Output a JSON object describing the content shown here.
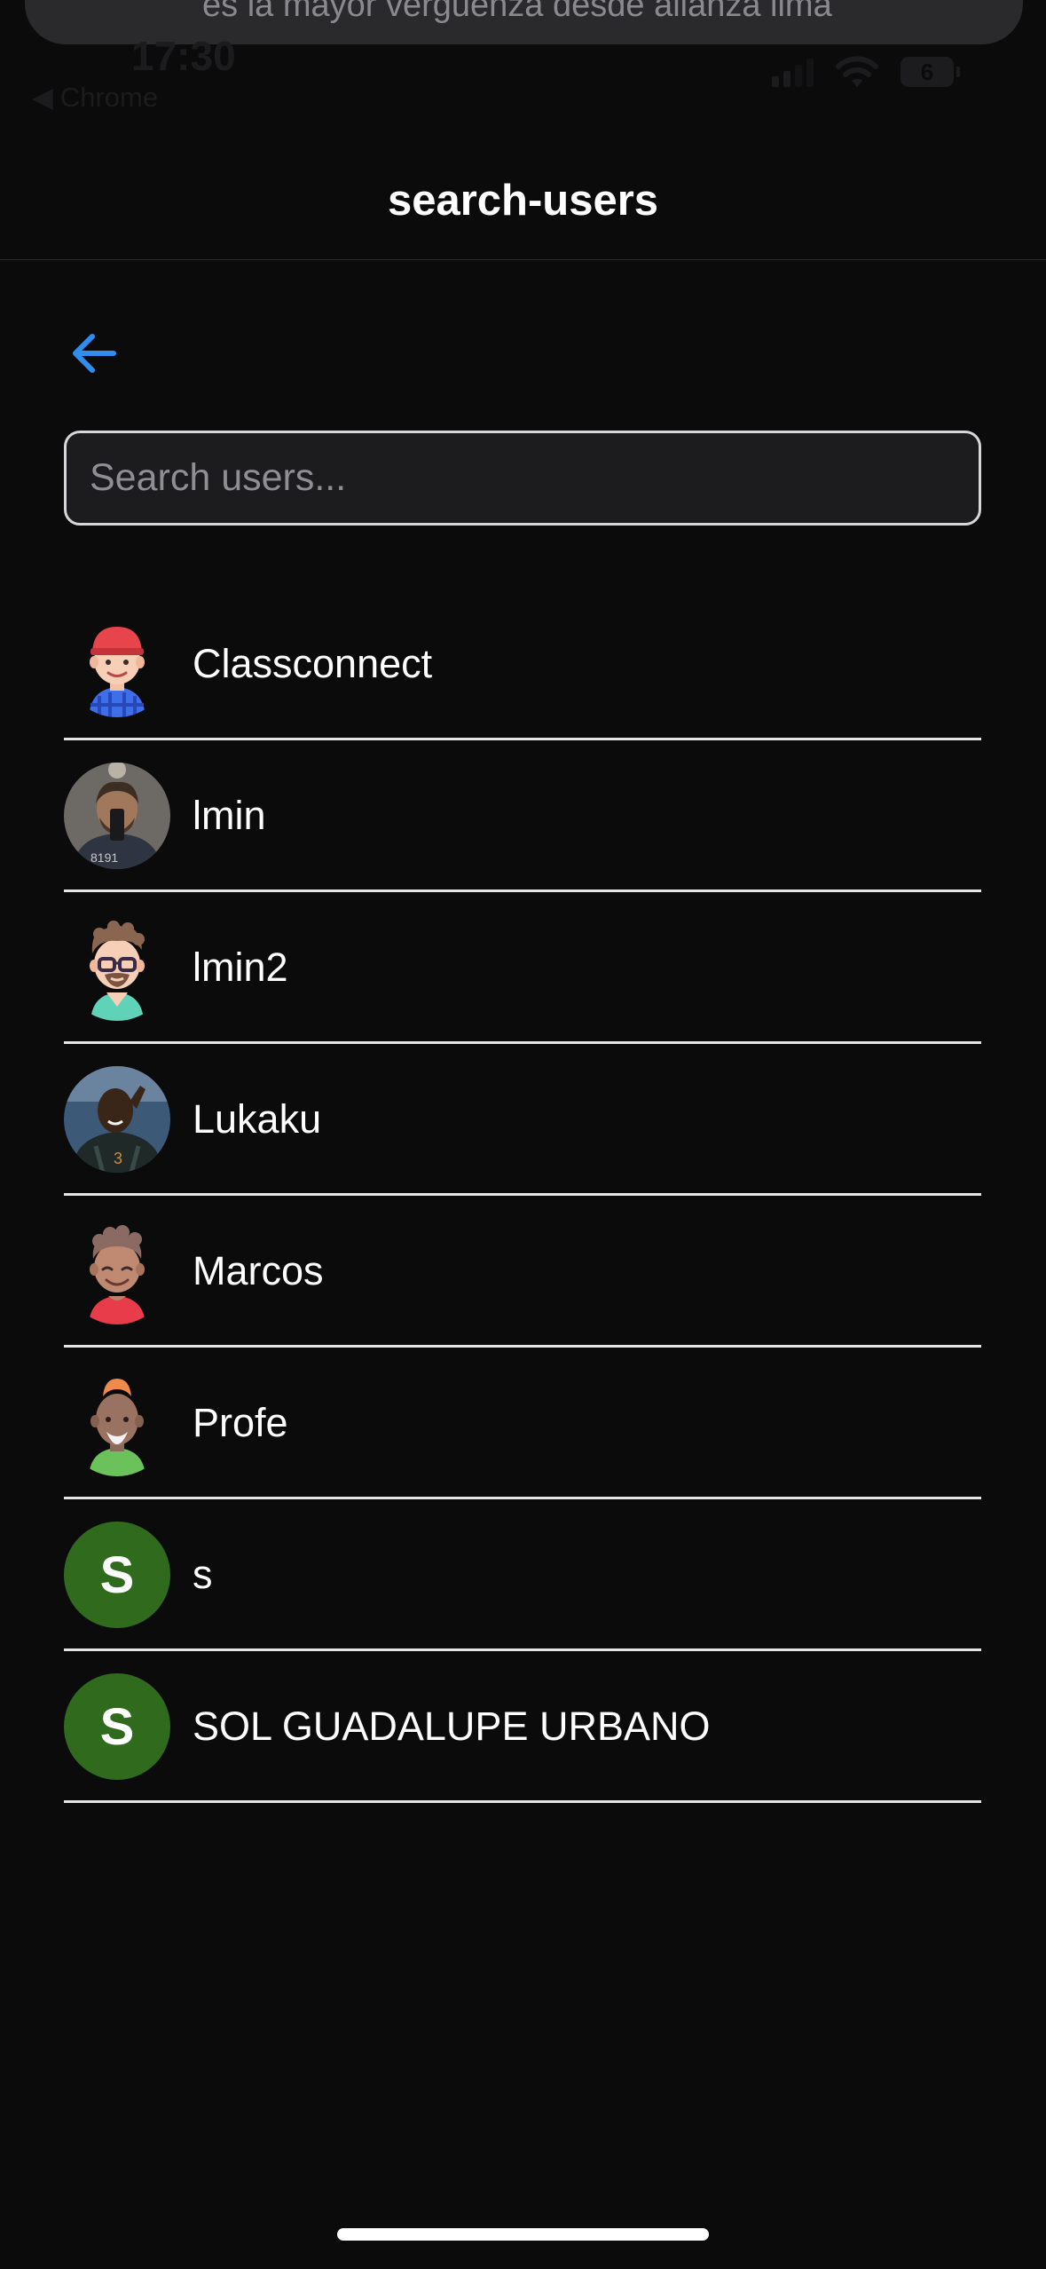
{
  "notification": {
    "text": "es la mayor verguenza desde alianza lima"
  },
  "status_bar": {
    "time": "17:30",
    "back_app": "Chrome",
    "battery": "6"
  },
  "header": {
    "title": "search-users"
  },
  "search": {
    "placeholder": "Search users...",
    "value": ""
  },
  "users": [
    {
      "name": "Classconnect",
      "avatar": "avatar-red-cap-icon",
      "letter": ""
    },
    {
      "name": "lmin",
      "avatar": "photo-avatar-selfie",
      "letter": ""
    },
    {
      "name": "lmin2",
      "avatar": "avatar-glasses-beard-icon",
      "letter": ""
    },
    {
      "name": "Lukaku",
      "avatar": "photo-avatar-footballer",
      "letter": ""
    },
    {
      "name": "Marcos",
      "avatar": "avatar-curly-hair-icon",
      "letter": ""
    },
    {
      "name": "Profe",
      "avatar": "avatar-bald-orange-hair-icon",
      "letter": ""
    },
    {
      "name": "s",
      "avatar": "letter-avatar",
      "letter": "S"
    },
    {
      "name": "SOL GUADALUPE URBANO",
      "avatar": "letter-avatar",
      "letter": "S"
    }
  ],
  "colors": {
    "background": "#0b0b0c",
    "accent_blue": "#2f8df0",
    "letter_avatar_green": "#2f6a1d",
    "divider": "#e5e5e7"
  }
}
